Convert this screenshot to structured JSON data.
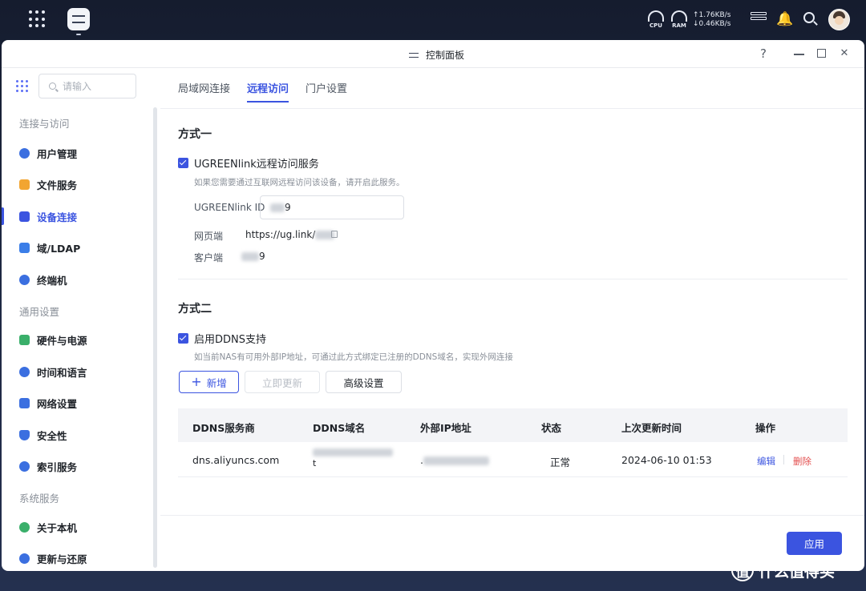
{
  "window": {
    "title": "控制面板",
    "help": "?",
    "close": "✕"
  },
  "topbar": {
    "cpu_label": "CPU",
    "ram_label": "RAM",
    "upload": "↑1.76KB/s",
    "download": "↓0.46KB/s",
    "bell": "🔔"
  },
  "sidebar": {
    "search_placeholder": "请输入",
    "sections": [
      "连接与访问",
      "通用设置",
      "系统服务"
    ],
    "items": [
      {
        "label": "用户管理",
        "icon": "user-icon",
        "color": "#3b6fe0"
      },
      {
        "label": "文件服务",
        "icon": "folder-icon",
        "color": "#f2a531"
      },
      {
        "label": "设备连接",
        "icon": "device-icon",
        "color": "#3b54e0"
      },
      {
        "label": "域/LDAP",
        "icon": "domain-icon",
        "color": "#3b7ee8"
      },
      {
        "label": "终端机",
        "icon": "terminal-icon",
        "color": "#3b6fe0"
      },
      {
        "label": "硬件与电源",
        "icon": "hardware-icon",
        "color": "#3aaf6a"
      },
      {
        "label": "时间和语言",
        "icon": "clock-icon",
        "color": "#3b6fe0"
      },
      {
        "label": "网络设置",
        "icon": "network-icon",
        "color": "#3b6fe0"
      },
      {
        "label": "安全性",
        "icon": "shield-icon",
        "color": "#3b6fe0"
      },
      {
        "label": "索引服务",
        "icon": "index-icon",
        "color": "#3b6fe0"
      },
      {
        "label": "关于本机",
        "icon": "info-icon",
        "color": "#3aaf6a"
      },
      {
        "label": "更新与还原",
        "icon": "refresh-icon",
        "color": "#3b6fe0"
      }
    ],
    "active_index": 2
  },
  "tabs": [
    "局域网连接",
    "远程访问",
    "门户设置"
  ],
  "method1": {
    "title": "方式一",
    "checkbox_label": "UGREENlink远程访问服务",
    "hint": "如果您需要通过互联网远程访问该设备，请开启此服务。",
    "id_label": "UGREENlink ID",
    "id_value": "9",
    "web_label": "网页端",
    "web_value": "https://ug.link/",
    "client_label": "客户端",
    "client_value": "9"
  },
  "method2": {
    "title": "方式二",
    "checkbox_label": "启用DDNS支持",
    "hint": "如当前NAS有可用外部IP地址，可通过此方式绑定已注册的DDNS域名，实现外网连接",
    "btn_add": "新增",
    "btn_update": "立即更新",
    "btn_advanced": "高级设置"
  },
  "table": {
    "headers": [
      "DDNS服务商",
      "DDNS域名",
      "外部IP地址",
      "状态",
      "上次更新时间",
      "操作"
    ],
    "rows": [
      {
        "provider": "dns.aliyuncs.com",
        "domain": "t",
        "ip": ".",
        "status": "正常",
        "updated": "2024-06-10 01:53",
        "edit": "编辑",
        "delete": "删除"
      }
    ]
  },
  "footer": {
    "apply": "应用"
  },
  "watermark": {
    "logo": "值",
    "text": "什么值得买"
  }
}
